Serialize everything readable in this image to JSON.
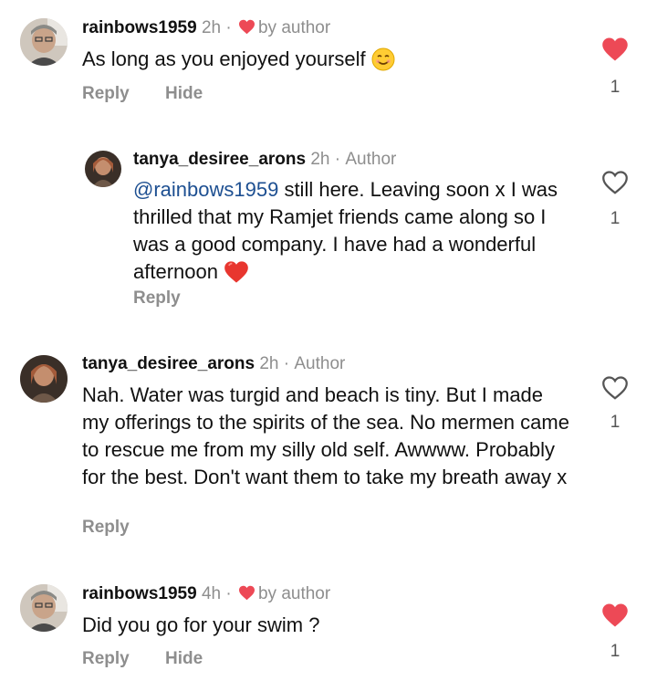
{
  "comments": [
    {
      "username": "rainbows1959",
      "time": "2h",
      "separator": "·",
      "badge": "by author",
      "text": "As long as you enjoyed yourself",
      "emoji": "smiling-face-emoji",
      "actions": [
        "Reply",
        "Hide"
      ],
      "liked": true,
      "like_count": "1"
    },
    {
      "username": "tanya_desiree_arons",
      "time": "2h",
      "separator": "·",
      "badge": "Author",
      "mention": "@rainbows1959",
      "text": " still here.  Leaving soon x I was thrilled that my Ramjet friends came along so  I was a good company. I have had a wonderful  afternoon",
      "emoji": "red-heart-emoji",
      "actions": [
        "Reply"
      ],
      "liked": false,
      "like_count": "1"
    },
    {
      "username": "tanya_desiree_arons",
      "time": "2h",
      "separator": "·",
      "badge": "Author",
      "text": "Nah.  Water was turgid and beach is tiny.  But I made my offerings to the spirits of the sea.  No mermen came to rescue me from my silly old self.  Awwww.  Probably for the best.  Don't want them to take my breath away x",
      "actions": [
        "Reply"
      ],
      "liked": false,
      "like_count": "1"
    },
    {
      "username": "rainbows1959",
      "time": "4h",
      "separator": "·",
      "badge": "by author",
      "text": "Did you go for your swim ?",
      "actions": [
        "Reply",
        "Hide"
      ],
      "liked": true,
      "like_count": "1"
    }
  ],
  "colors": {
    "like_red": "#ed4956",
    "mention_blue": "#1d4f91",
    "meta_gray": "#8e8e8e"
  }
}
